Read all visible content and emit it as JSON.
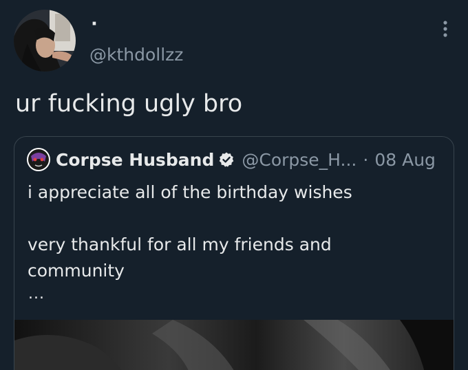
{
  "tweet": {
    "author": {
      "display_name": "·",
      "handle": "@kthdollzz",
      "avatar_icon": "profile-photo"
    },
    "more_icon": "more-vertical-icon",
    "text": "ur fucking ugly bro"
  },
  "quoted_tweet": {
    "author": {
      "display_name": "Corpse Husband",
      "handle": "@Corpse_H...",
      "verified": true,
      "avatar_icon": "profile-photo"
    },
    "separator": "·",
    "date": "08 Aug",
    "lines": [
      "i appreciate all of the birthday wishes",
      "very thankful for all my friends and",
      "community"
    ],
    "truncation": "...",
    "media_icon": "photo-thumbnail"
  },
  "colors": {
    "background": "#15202b",
    "text_primary": "#e7e9ea",
    "text_secondary": "#8b98a5",
    "border": "#38444d",
    "verified_badge": "#e7e9ea"
  }
}
